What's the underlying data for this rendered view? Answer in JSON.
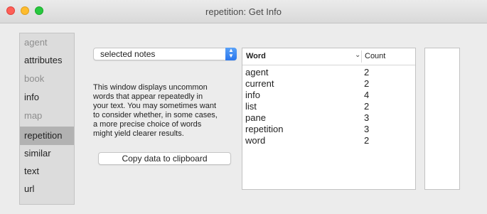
{
  "window": {
    "title": "repetition: Get Info"
  },
  "sidebar": {
    "items": [
      {
        "label": "agent",
        "state": "dim"
      },
      {
        "label": "attributes",
        "state": "normal"
      },
      {
        "label": "book",
        "state": "dim"
      },
      {
        "label": "info",
        "state": "normal"
      },
      {
        "label": "map",
        "state": "dim"
      },
      {
        "label": "repetition",
        "state": "selected"
      },
      {
        "label": "similar",
        "state": "normal"
      },
      {
        "label": "text",
        "state": "normal"
      },
      {
        "label": "url",
        "state": "normal"
      }
    ]
  },
  "scope_select": {
    "value": "selected notes"
  },
  "description": "This window displays uncommon\nwords that appear repeatedly  in\nyour text. You may sometimes want\nto consider whether, in some cases,\na more precise choice of words\nmight yield clearer results.",
  "copy_button": {
    "label": "Copy data to clipboard"
  },
  "table": {
    "headers": {
      "word": "Word",
      "count": "Count"
    },
    "rows": [
      {
        "word": "agent",
        "count": "2"
      },
      {
        "word": "current",
        "count": "2"
      },
      {
        "word": "info",
        "count": "4"
      },
      {
        "word": "list",
        "count": "2"
      },
      {
        "word": "pane",
        "count": "3"
      },
      {
        "word": "repetition",
        "count": "3"
      },
      {
        "word": "word",
        "count": "2"
      }
    ]
  },
  "colors": {
    "selected_item": "#b2b2b2",
    "select_accent": "#2a76ec"
  }
}
